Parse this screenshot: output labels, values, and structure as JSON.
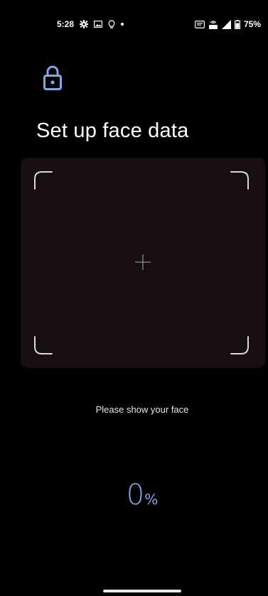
{
  "status_bar": {
    "time": "5:28",
    "battery": "75%",
    "left_icons": [
      "gear-icon",
      "image-icon",
      "lightbulb-icon",
      "dot-icon"
    ],
    "right_icons": [
      "nfc-icon",
      "volte-icon",
      "signal-icon",
      "battery-icon"
    ]
  },
  "header": {
    "icon": "lock-icon",
    "title": "Set up face data"
  },
  "camera": {
    "crosshair": "plus-icon"
  },
  "instruction": "Please show your face",
  "progress": {
    "value": "0",
    "unit": "%"
  },
  "colors": {
    "accent": "#7fa8e8",
    "background": "#000000",
    "preview": "#160e12"
  }
}
